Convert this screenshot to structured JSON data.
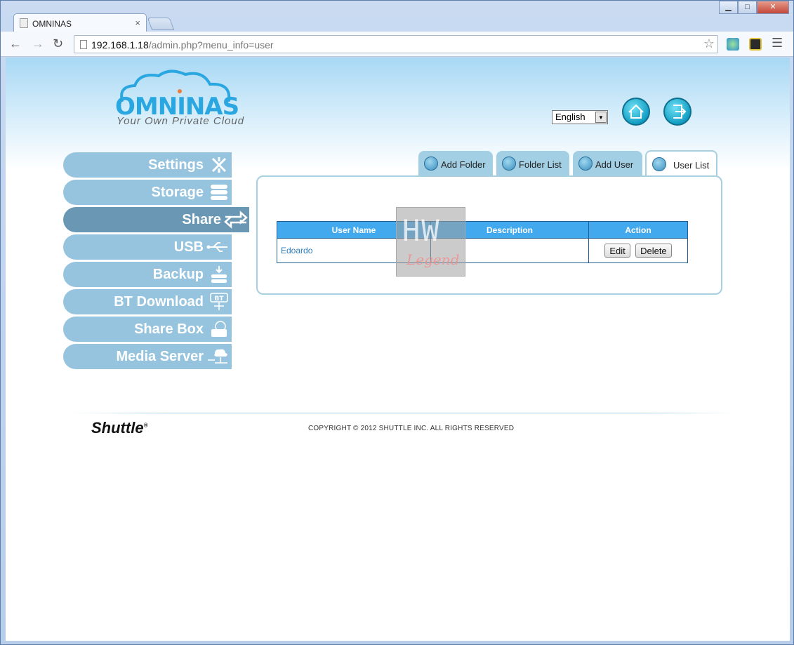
{
  "browser": {
    "tab_title": "OMNINAS",
    "tab_close": "×",
    "url_host": "192.168.1.18",
    "url_path": "/admin.php?menu_info=user",
    "window_buttons": {
      "minimize": "▁",
      "maximize": "□",
      "close": "✕"
    }
  },
  "header": {
    "logo_text": "OMNINAS",
    "logo_tagline": "Your Own Private Cloud",
    "language": "English"
  },
  "sidebar": {
    "items": [
      {
        "label": "Settings",
        "icon": "tools-icon"
      },
      {
        "label": "Storage",
        "icon": "storage-icon"
      },
      {
        "label": "Share",
        "icon": "share-arrows-icon",
        "active": true
      },
      {
        "label": "USB",
        "icon": "usb-icon"
      },
      {
        "label": "Backup",
        "icon": "backup-icon"
      },
      {
        "label": "BT Download",
        "icon": "bt-icon"
      },
      {
        "label": "Share Box",
        "icon": "sharebox-icon"
      },
      {
        "label": "Media Server",
        "icon": "media-server-icon"
      }
    ]
  },
  "tabs": [
    {
      "label": "Add Folder"
    },
    {
      "label": "Folder List"
    },
    {
      "label": "Add User"
    },
    {
      "label": "User List",
      "active": true
    }
  ],
  "user_table": {
    "headers": [
      "User Name",
      "Description",
      "Action"
    ],
    "rows": [
      {
        "name": "Edoardo",
        "description": "",
        "edit_label": "Edit",
        "delete_label": "Delete"
      }
    ]
  },
  "watermark": {
    "top": "HW",
    "bottom": "Legend"
  },
  "footer": {
    "brand": "Shuttle",
    "copyright": "COPYRIGHT © 2012 SHUTTLE INC. ALL RIGHTS RESERVED"
  },
  "colors": {
    "accent": "#2aa7e0",
    "nav": "#96c4de",
    "nav_active": "#6a98b4",
    "table_header": "#42a9ee"
  }
}
